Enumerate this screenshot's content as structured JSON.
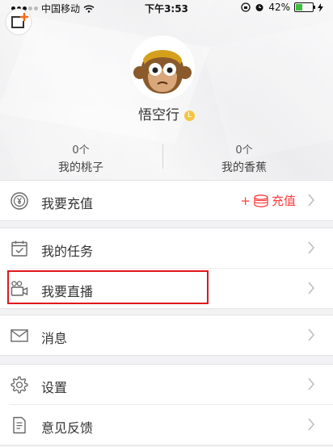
{
  "status_bar": {
    "carrier": "中国移动",
    "time": "下午3:53",
    "battery_percent": "42%",
    "battery_level": 0.42
  },
  "profile": {
    "username": "悟空行",
    "level_badge": "L"
  },
  "stats": [
    {
      "value": "0个",
      "label": "我的桃子"
    },
    {
      "value": "0个",
      "label": "我的香蕉"
    }
  ],
  "menu": {
    "recharge": {
      "label": "我要充值",
      "extra_prefix": "+",
      "extra_label": "充值"
    },
    "tasks": {
      "label": "我的任务"
    },
    "live": {
      "label": "我要直播"
    },
    "messages": {
      "label": "消息"
    },
    "settings": {
      "label": "设置"
    },
    "feedback": {
      "label": "意见反馈"
    }
  },
  "colors": {
    "accent": "#ff3b3b",
    "highlight_box": "#e0171e",
    "corner_plus": "#f26b1d"
  }
}
